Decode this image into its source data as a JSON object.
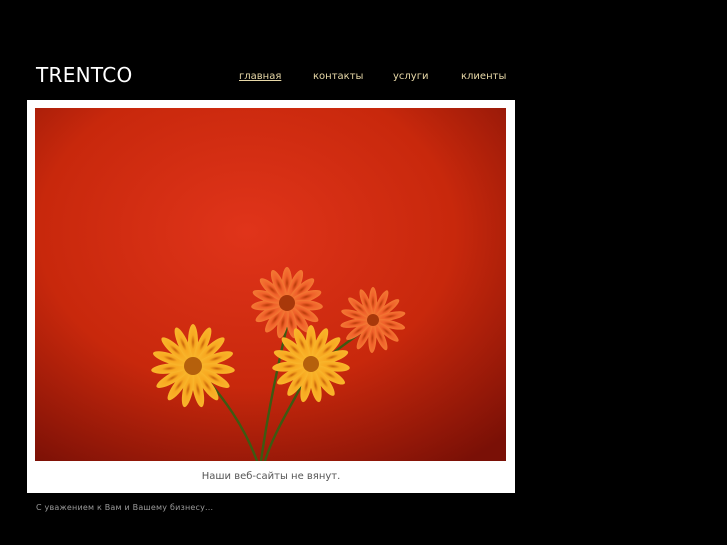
{
  "brand": {
    "logo": "TRENTCO"
  },
  "nav": {
    "items": [
      {
        "label": "главная",
        "active": true
      },
      {
        "label": "контакты",
        "active": false
      },
      {
        "label": "услуги",
        "active": false
      },
      {
        "label": "клиенты",
        "active": false
      }
    ]
  },
  "main": {
    "caption": "Наши веб-сайты не вянут."
  },
  "footer": {
    "text": "С уважением к Вам и Вашему бизнесу..."
  },
  "colors": {
    "background": "#000000",
    "nav_link": "#e8d9a8",
    "frame": "#ffffff",
    "photo_wall": "#c82a0e",
    "flower_orange": "#f5a11c",
    "flower_red": "#ef5a1e"
  }
}
